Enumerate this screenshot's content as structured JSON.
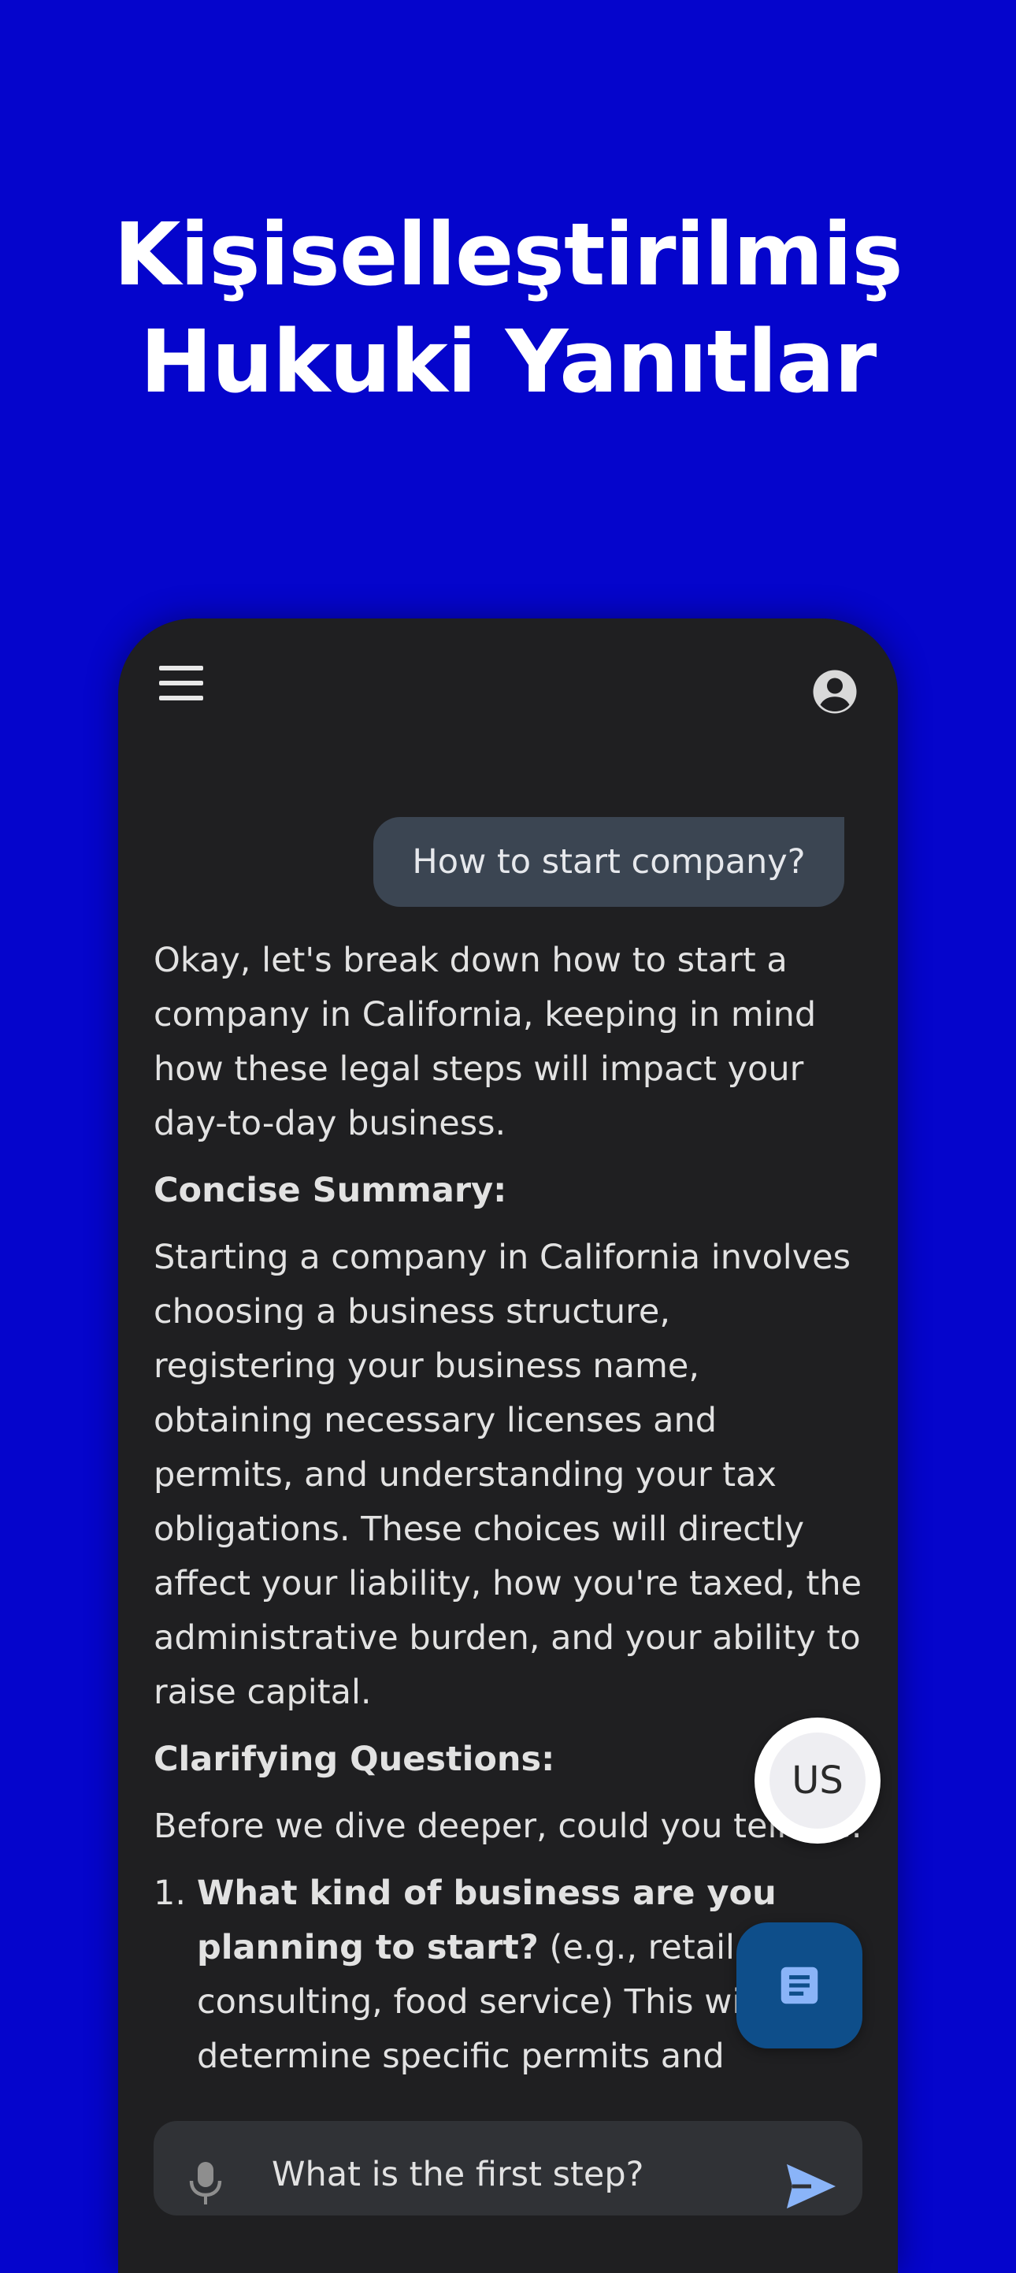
{
  "hero": {
    "title_line1": "Kişiselleştirilmiş",
    "title_line2": "Hukuki Yanıtlar"
  },
  "header": {
    "menu_icon": "hamburger-menu-icon",
    "account_icon": "account-circle-icon"
  },
  "chat": {
    "user_message": "How to start company?",
    "reply": {
      "intro": "Okay, let's break down how to start a company in California, keeping in mind how these legal steps will impact your day-to-day business.",
      "summary_heading": "Concise Summary:",
      "summary_text": "Starting a company in California involves choosing a business structure, registering your business name, obtaining necessary licenses and permits, and understanding your tax obligations. These choices will directly affect your liability, how you're taxed, the administrative burden, and your ability to raise capital.",
      "questions_heading": "Clarifying Questions:",
      "questions_intro": "Before we dive deeper, could you tell me:",
      "questions": [
        {
          "number": "1.",
          "bold": "What kind of business are you planning to start?",
          "text": " (e.g., retail, tech, consulting, food service) This will help determine specific permits and"
        }
      ]
    }
  },
  "fab": {
    "region_label": "US",
    "doc_icon": "document-icon"
  },
  "composer": {
    "value": "What is the first step?",
    "mic_icon": "microphone-icon",
    "send_icon": "send-icon"
  },
  "colors": {
    "background": "#0505cc",
    "phone_surface": "#1f1f21",
    "user_bubble": "#3b4552",
    "doc_fab": "#0e4e8a",
    "send_accent": "#8ab4f8"
  }
}
